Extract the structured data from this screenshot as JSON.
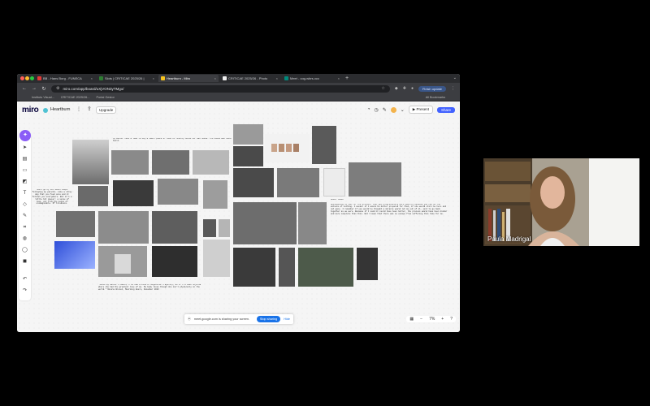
{
  "browser": {
    "tabs": [
      {
        "label": "BB - Hans Borg - FUNECA",
        "color": "#e53935"
      },
      {
        "label": "Slots | CRITICAE 2025/26 |",
        "color": "#2e7d32"
      },
      {
        "label": "Heartburn - Miro",
        "color": "#f6c31f"
      },
      {
        "label": "CRITICAE 2025/26 - Photo",
        "color": "#eeeeee"
      },
      {
        "label": "Meet - cog-wbrs-xcc",
        "color": "#00897b"
      }
    ],
    "active_tab": "Heartburn - Miro",
    "url": "miro.com/app/board/uXjVON3yTMgo/",
    "update_label": "Finish update",
    "bookmarks": [
      "Instituto Visual...",
      "CRITICAE 2025/26...",
      "Portal Gestor"
    ],
    "all_bookmarks": "All Bookmarks"
  },
  "miro": {
    "logo": "miro",
    "board_name": "Heartburn",
    "upgrade": "Upgrade",
    "present": "Present",
    "share": "Share",
    "zoom": "7%",
    "notes": {
      "top": "My mother took a loan to buy a small piece of land to finally build her own house. The house was never built.",
      "left": "Years go by but death keeps following my parents. Like a stray dog that you feed once and it follows you everywhere. But it's a little bit deeper: a sense of loss, cut from the sense of unimaginable. Of tiredness.",
      "bottom": "\"Since my mother's death, I've had a kind of digestive fragility, as if I'd been injured where she had the greatest love of me. My body lives though she isn't physically in the world.\" Nicole Brenez, Mourning Hours, December 2023",
      "right_title": "About lemon",
      "right": "Apologising to you for the process, that got progressively more painful because you can be the witness of nothing. I wonder if I would be better prepared for that, if she would still be here and not gone. I remember if you would've thought a miracle would let me out of it, just to go back together as we were. Because if I said it could have been better, the process would have been kinder and more complete than this. But I mean that there was no escape from suffering this time for me."
    },
    "share_bar": {
      "text": "meet.google.com is sharing your screen.",
      "stop": "Stop sharing",
      "hide": "Hide"
    }
  },
  "participant": {
    "name": "Paula Madrigal"
  }
}
